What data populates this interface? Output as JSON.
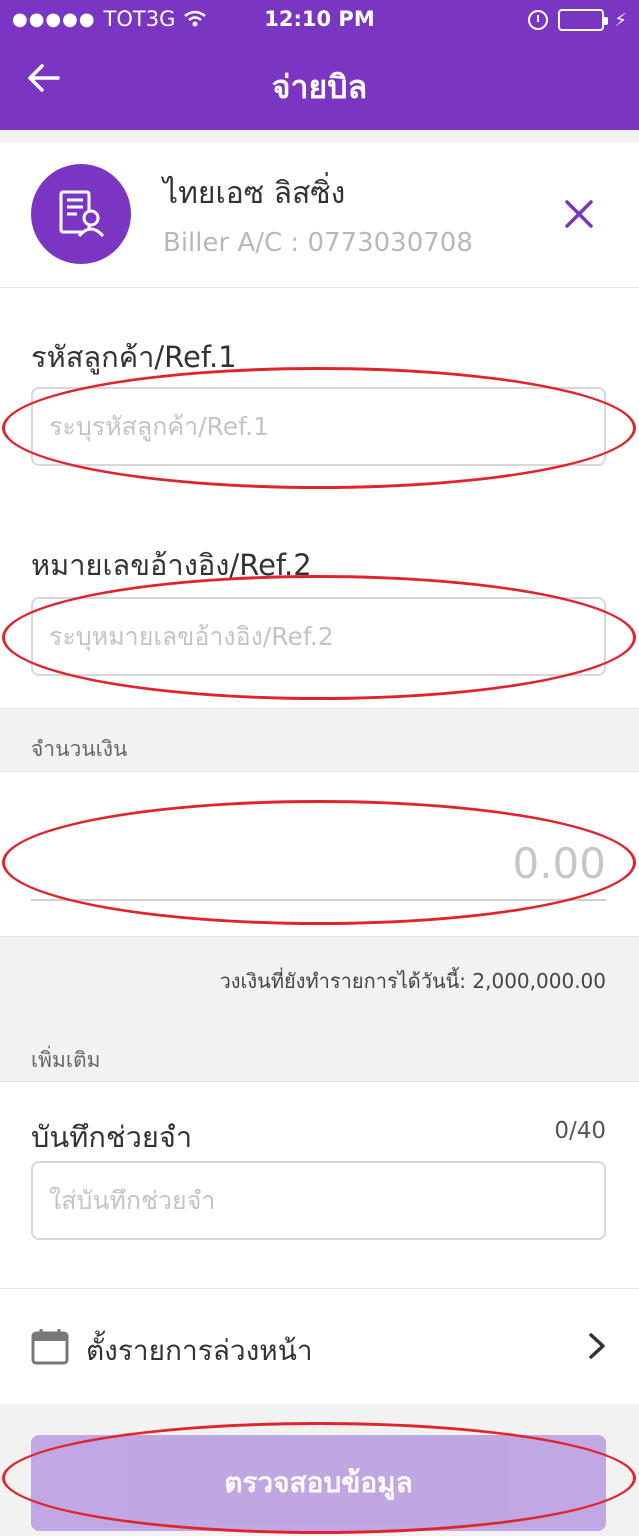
{
  "status_bar": {
    "carrier": "TOT3G",
    "time": "12:10 PM"
  },
  "header": {
    "title": "จ่ายบิล"
  },
  "biller": {
    "name": "ไทยเอซ ลิสซิ่ง",
    "account": "Biller A/C : 0773030708"
  },
  "ref1": {
    "label": "รหัสลูกค้า/Ref.1",
    "placeholder": "ระบุรหัสลูกค้า/Ref.1"
  },
  "ref2": {
    "label": "หมายเลขอ้างอิง/Ref.2",
    "placeholder": "ระบุหมายเลขอ้างอิง/Ref.2"
  },
  "amount": {
    "section_title": "จำนวนเงิน",
    "placeholder": "0.00",
    "limit_text": "วงเงินที่ยังทำรายการได้วันนี้: 2,000,000.00"
  },
  "extra": {
    "section_title": "เพิ่มเติม",
    "memo_label": "บันทึกช่วยจำ",
    "memo_counter": "0/40",
    "memo_placeholder": "ใส่บันทึกช่วยจำ"
  },
  "schedule": {
    "label": "ตั้งรายการล่วงหน้า"
  },
  "submit": {
    "label": "ตรวจสอบข้อมูล"
  },
  "colors": {
    "brand": "#7b35c3",
    "button_disabled": "#b89ae0",
    "annotation": "#e0242c"
  }
}
